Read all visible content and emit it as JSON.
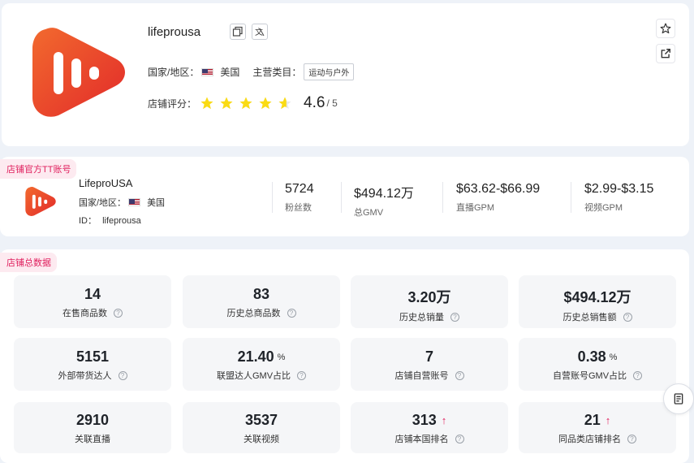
{
  "store": {
    "name": "lifeprousa",
    "region_label": "国家/地区：",
    "region": "美国",
    "category_label": "主营类目：",
    "category": "运动与户外",
    "rating_label": "店铺评分：",
    "rating": 4.6,
    "rating_display": "4.6",
    "rating_max": "/ 5",
    "brand_gradient": [
      "#f0552d",
      "#e62d2d"
    ]
  },
  "tt_account": {
    "section_tag": "店铺官方TT账号",
    "name": "LifeproUSA",
    "region_label": "国家/地区：",
    "region": "美国",
    "id_label": "ID：",
    "id": "lifeprousa",
    "metrics": [
      {
        "value": "5724",
        "label": "粉丝数"
      },
      {
        "value": "$494.12万",
        "label": "总GMV"
      },
      {
        "value": "$63.62-$66.99",
        "label": "直播GPM"
      },
      {
        "value": "$2.99-$3.15",
        "label": "视频GPM"
      }
    ]
  },
  "stats": {
    "section_tag": "店铺总数据",
    "items": [
      {
        "value": "14",
        "label": "在售商品数",
        "help": "?"
      },
      {
        "value": "83",
        "label": "历史总商品数",
        "help": "?"
      },
      {
        "value": "3.20万",
        "label": "历史总销量",
        "help": "?"
      },
      {
        "value": "$494.12万",
        "label": "历史总销售额",
        "help": "?"
      },
      {
        "value": "5151",
        "label": "外部带货达人",
        "help": "?"
      },
      {
        "value": "21.40",
        "unit": "%",
        "label": "联盟达人GMV占比",
        "help": "?"
      },
      {
        "value": "7",
        "label": "店铺自营账号",
        "help": "?"
      },
      {
        "value": "0.38",
        "unit": "%",
        "label": "自营账号GMV占比",
        "help": "?"
      },
      {
        "value": "2910",
        "label": "关联直播"
      },
      {
        "value": "3537",
        "label": "关联视频"
      },
      {
        "value": "313",
        "trend": "↑",
        "label": "店铺本国排名",
        "help": "?"
      },
      {
        "value": "21",
        "trend": "↑",
        "label": "同品类店铺排名",
        "help": "?"
      }
    ]
  },
  "icons": {
    "copy": "copy-icon",
    "translate": "translate-icon",
    "favorite": "star-outline-icon",
    "external": "external-link-icon",
    "doc": "document-icon"
  },
  "colors": {
    "accent_pink": "#e0205e",
    "star_gold": "#fadb14"
  }
}
